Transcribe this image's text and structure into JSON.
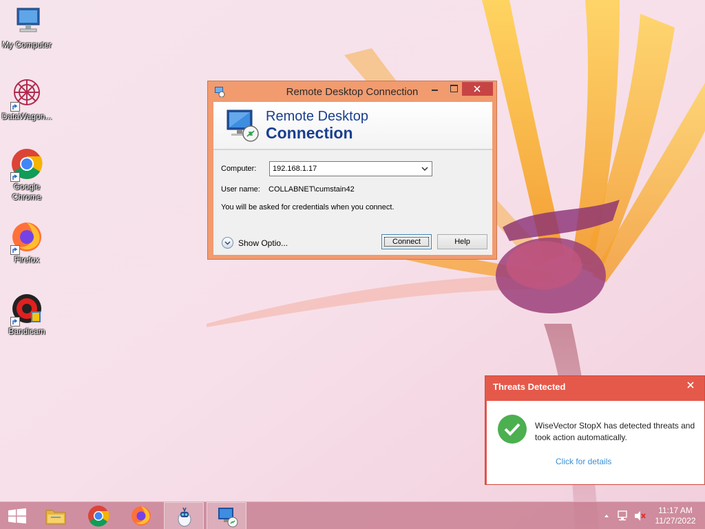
{
  "desktop": {
    "icons": [
      {
        "label": "My Computer"
      },
      {
        "label": "DataWagon..."
      },
      {
        "label": "Google Chrome"
      },
      {
        "label": "Firefox"
      },
      {
        "label": "Bandicam"
      }
    ]
  },
  "rdc_window": {
    "title": "Remote Desktop Connection",
    "banner_line1": "Remote Desktop",
    "banner_line2": "Connection",
    "computer_label": "Computer:",
    "computer_value": "192.168.1.17",
    "username_label": "User name:",
    "username_value": "COLLABNET\\cumstain42",
    "info_text": "You will be asked for credentials when you connect.",
    "show_options_label": "Show Optio...",
    "connect_label": "Connect",
    "help_label": "Help"
  },
  "threats_popup": {
    "title": "Threats Detected",
    "message": "WiseVector StopX has detected threats and took action automatically.",
    "link": "Click for details"
  },
  "taskbar": {
    "time": "11:17 AM",
    "date": "11/27/2022",
    "apps": [
      "file-explorer-icon",
      "chrome-icon",
      "firefox-icon",
      "wisevector-icon",
      "remote-desktop-icon"
    ]
  },
  "colors": {
    "window_frame": "#f19b6f",
    "close_button": "#c74444",
    "threat_header": "#e5594a",
    "banner_text": "#1a3f8f",
    "link": "#3b8fd6"
  }
}
